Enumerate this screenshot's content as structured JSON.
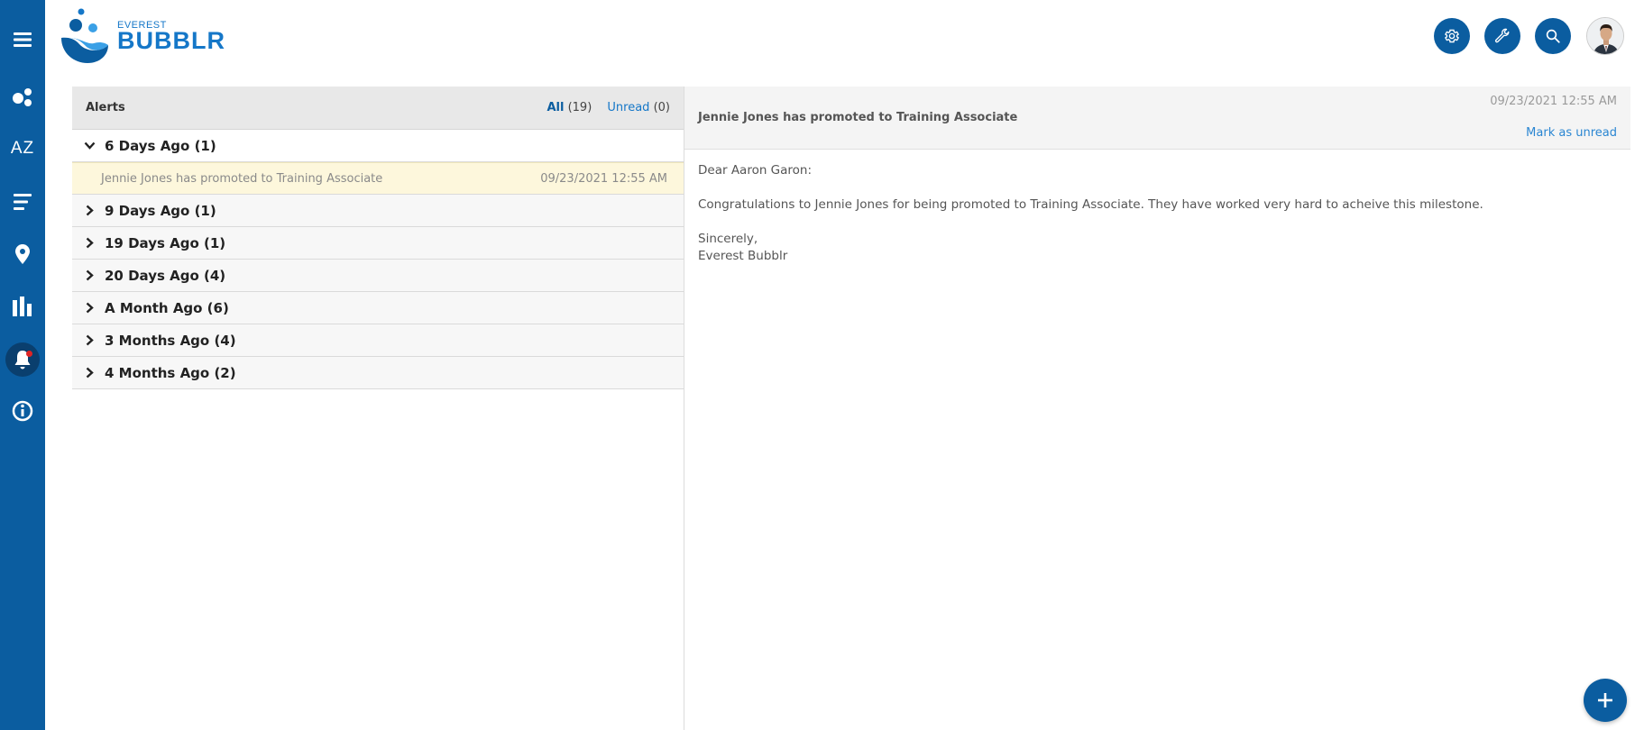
{
  "sidebar": {
    "items": [
      {
        "icon": "menu-icon"
      },
      {
        "icon": "bubbles-icon"
      },
      {
        "icon": "az-icon",
        "label": "AZ"
      },
      {
        "icon": "list-icon"
      },
      {
        "icon": "location-pin-icon"
      },
      {
        "icon": "bar-chart-icon"
      },
      {
        "icon": "bell-icon",
        "active": true
      },
      {
        "icon": "info-icon"
      }
    ]
  },
  "header": {
    "logo_small": "EVEREST",
    "logo_big": "BUBBLR",
    "buttons": [
      {
        "icon": "gear-icon"
      },
      {
        "icon": "wrench-icon"
      },
      {
        "icon": "search-icon"
      }
    ]
  },
  "alerts": {
    "title": "Alerts",
    "filters": {
      "all_label": "All",
      "all_count": "(19)",
      "unread_label": "Unread",
      "unread_count": "(0)"
    },
    "groups": [
      {
        "label": "6 Days Ago (1)",
        "expanded": true
      },
      {
        "label": "9 Days Ago (1)",
        "expanded": false
      },
      {
        "label": "19 Days Ago (1)",
        "expanded": false
      },
      {
        "label": "20 Days Ago (4)",
        "expanded": false
      },
      {
        "label": "A Month Ago (6)",
        "expanded": false
      },
      {
        "label": "3 Months Ago (4)",
        "expanded": false
      },
      {
        "label": "4 Months Ago (2)",
        "expanded": false
      }
    ],
    "expanded_item": {
      "text": "Jennie Jones has promoted to Training Associate",
      "date": "09/23/2021 12:55 AM"
    }
  },
  "message": {
    "date": "09/23/2021 12:55 AM",
    "subject": "Jennie Jones has promoted to Training Associate",
    "mark_unread_label": "Mark as unread",
    "greeting": "Dear Aaron Garon:",
    "body": "Congratulations to Jennie Jones for being promoted to Training Associate. They have worked very hard to acheive this milestone.",
    "closing": "Sincerely,",
    "signature": "Everest Bubblr"
  },
  "colors": {
    "primary": "#0b5da0",
    "link": "#1577c8",
    "highlight_row": "#fdf7dc",
    "notification_dot": "#e02424"
  }
}
